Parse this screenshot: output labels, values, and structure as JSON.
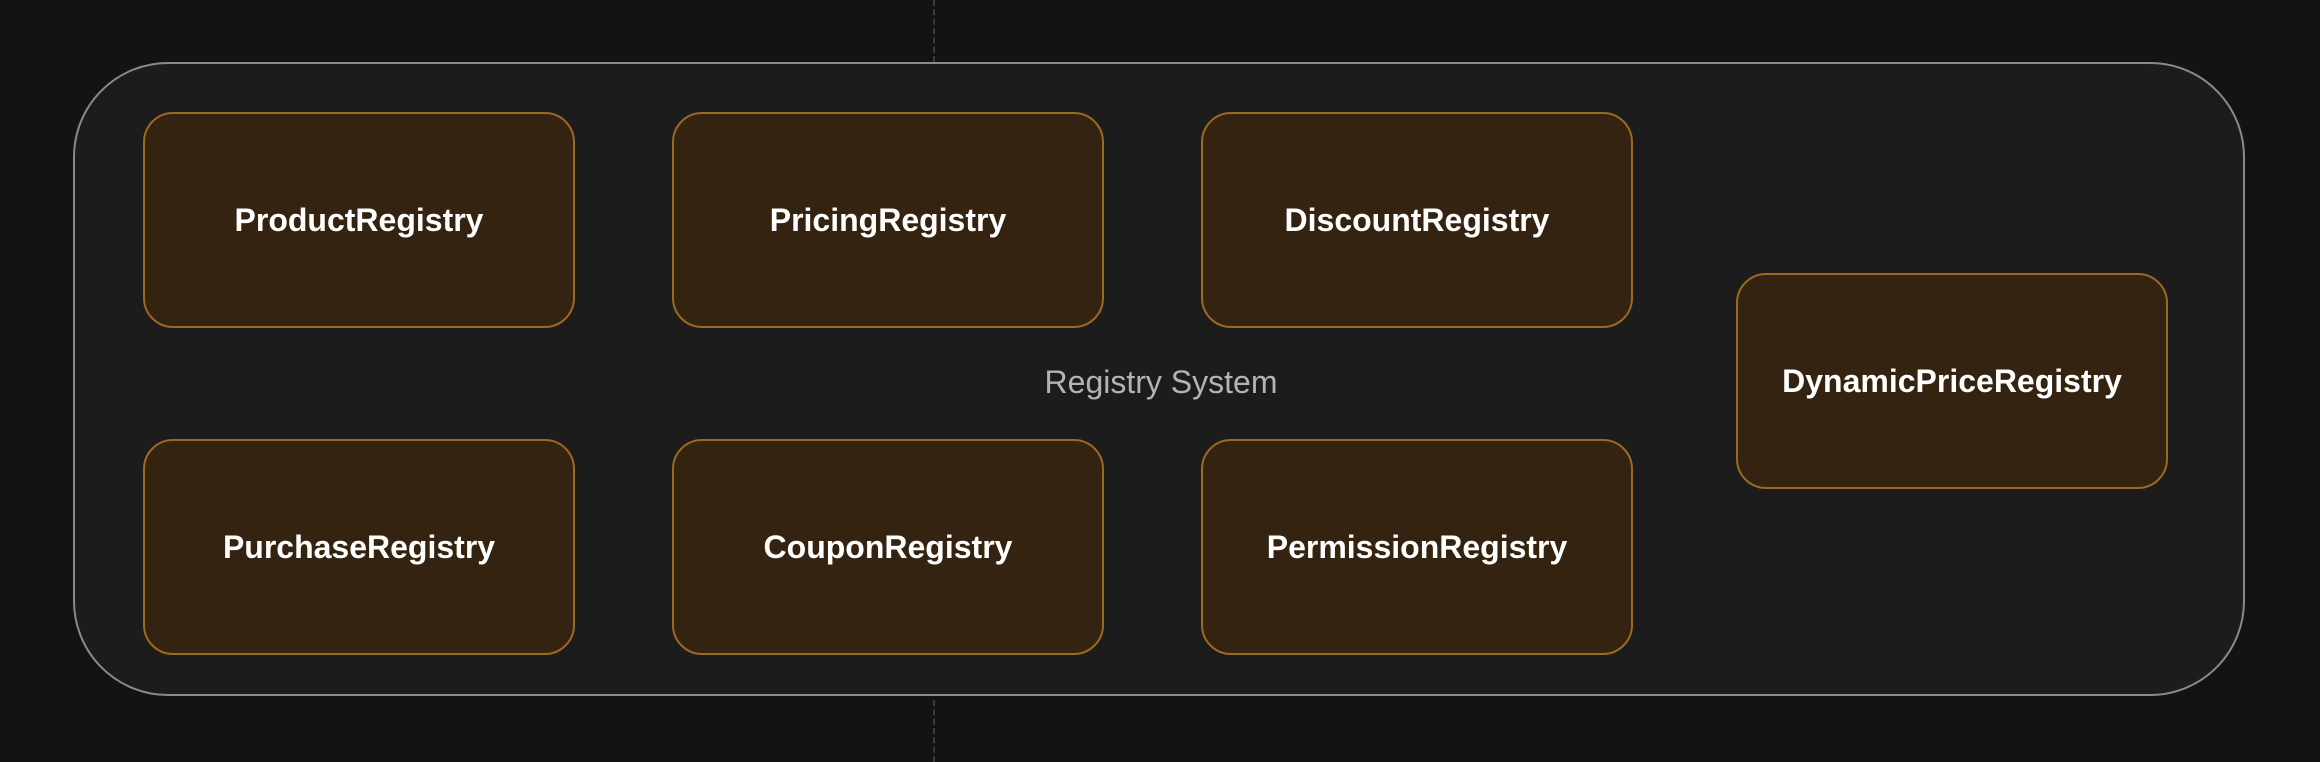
{
  "group": {
    "label": "Registry System"
  },
  "nodes": {
    "product": "ProductRegistry",
    "pricing": "PricingRegistry",
    "discount": "DiscountRegistry",
    "purchase": "PurchaseRegistry",
    "coupon": "CouponRegistry",
    "permission": "PermissionRegistry",
    "dynamic_price": "DynamicPriceRegistry"
  },
  "colors": {
    "background": "#131313",
    "group_fill": "#1c1c1c",
    "group_border": "#8a8a8a",
    "node_fill": "#352312",
    "node_border": "#9a6a22",
    "node_text": "#ffffff",
    "group_label_text": "#b3b3b3"
  }
}
